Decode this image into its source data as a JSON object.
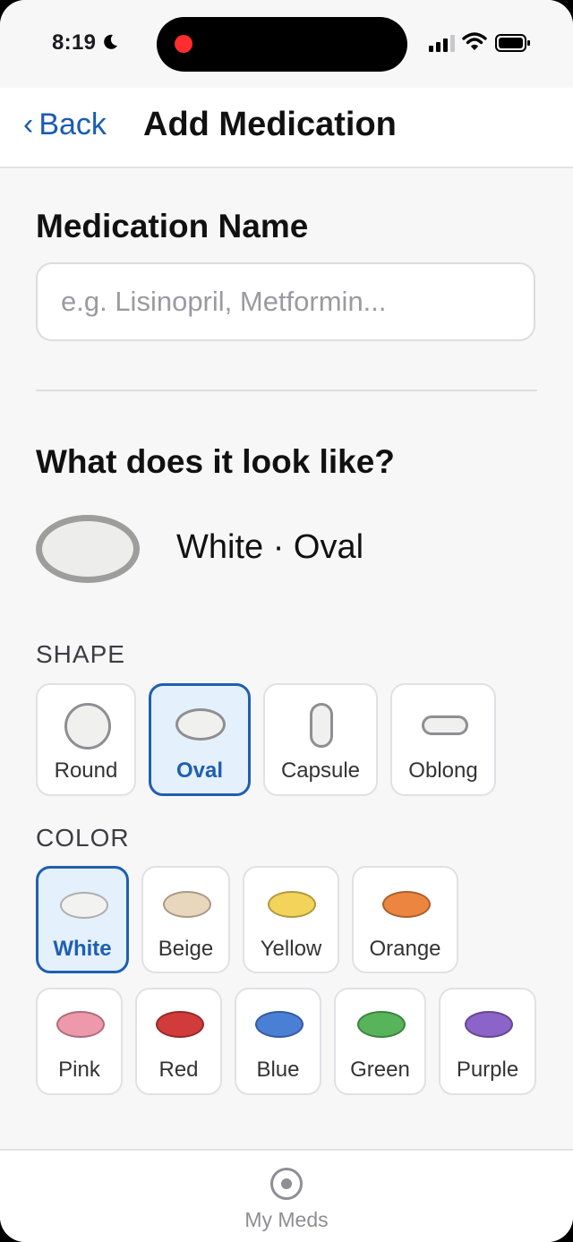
{
  "status_bar": {
    "time": "8:19"
  },
  "nav": {
    "back_label": "Back",
    "title": "Add Medication"
  },
  "medication_name": {
    "label": "Medication Name",
    "placeholder": "e.g. Lisinopril, Metformin...",
    "value": ""
  },
  "appearance": {
    "heading": "What does it look like?",
    "summary": "White · Oval",
    "preview_color": "#ededeb"
  },
  "shape": {
    "caption": "SHAPE",
    "options": [
      {
        "label": "Round",
        "icon": "round-pill-icon",
        "selected": false
      },
      {
        "label": "Oval",
        "icon": "oval-pill-icon",
        "selected": true
      },
      {
        "label": "Capsule",
        "icon": "capsule-pill-icon",
        "selected": false
      },
      {
        "label": "Oblong",
        "icon": "oblong-pill-icon",
        "selected": false
      }
    ]
  },
  "color": {
    "caption": "COLOR",
    "options": [
      {
        "label": "White",
        "hex": "#f2f2f0",
        "selected": true
      },
      {
        "label": "Beige",
        "hex": "#e8d6bd",
        "selected": false
      },
      {
        "label": "Yellow",
        "hex": "#f4d35b",
        "selected": false
      },
      {
        "label": "Orange",
        "hex": "#ec8540",
        "selected": false
      },
      {
        "label": "Pink",
        "hex": "#ee98ac",
        "selected": false
      },
      {
        "label": "Red",
        "hex": "#d23b3b",
        "selected": false
      },
      {
        "label": "Blue",
        "hex": "#4a7fd6",
        "selected": false
      },
      {
        "label": "Green",
        "hex": "#57b45a",
        "selected": false
      },
      {
        "label": "Purple",
        "hex": "#8c63c8",
        "selected": false
      }
    ]
  },
  "tab_bar": {
    "items": [
      {
        "label": "My Meds",
        "icon": "target-circle-icon"
      }
    ]
  },
  "accent_color": "#1f5fb0"
}
